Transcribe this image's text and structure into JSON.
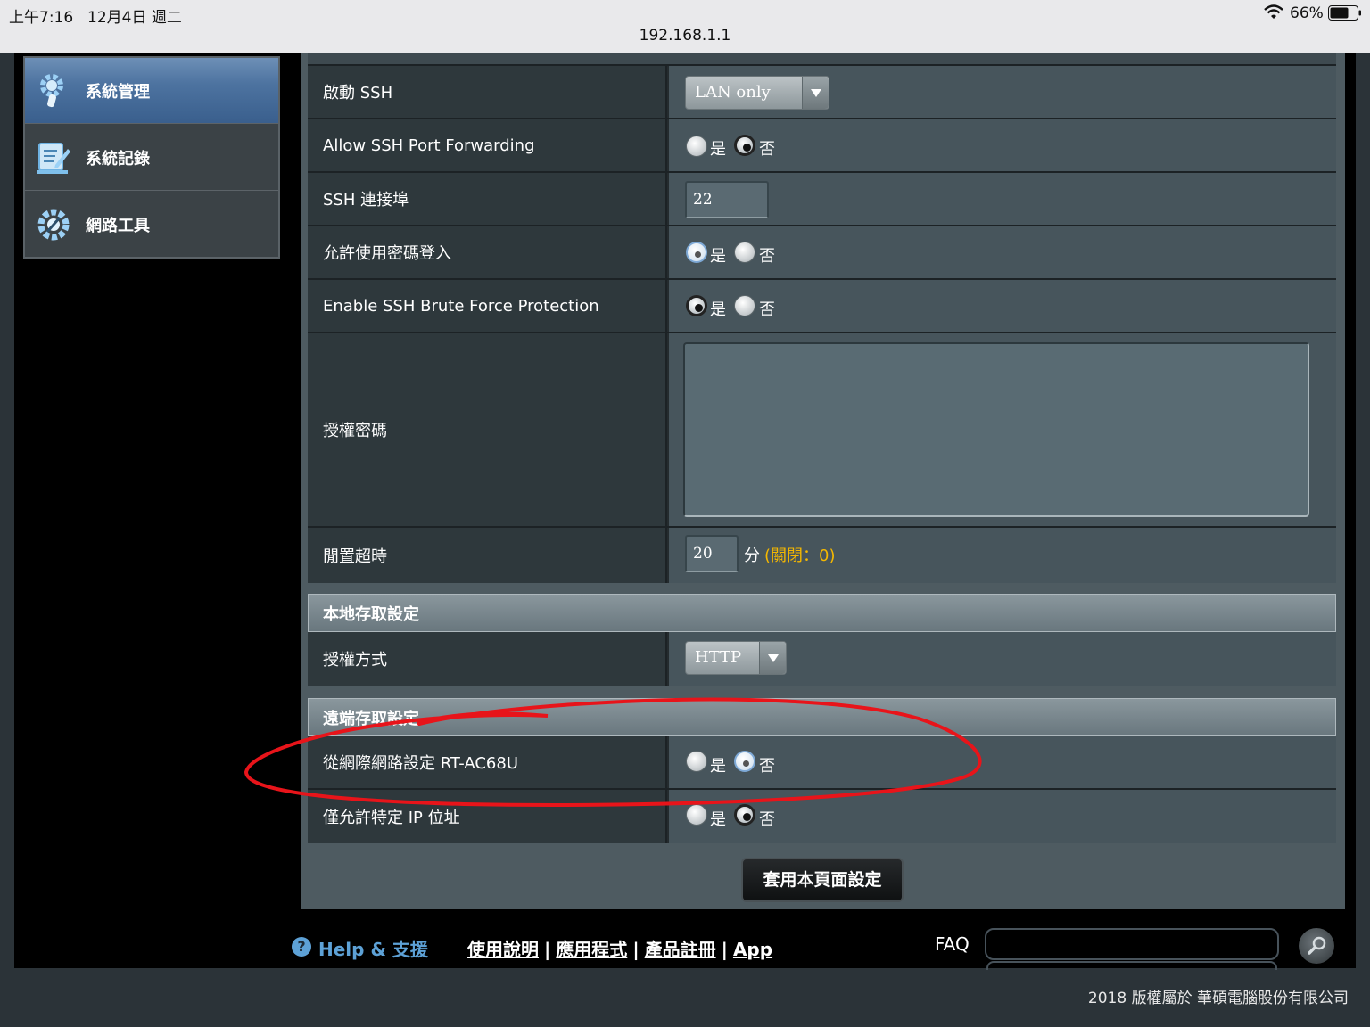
{
  "status_bar": {
    "time": "上午7:16",
    "date": "12月4日 週二",
    "url": "192.168.1.1",
    "battery_pct": "66%"
  },
  "menu": [
    {
      "label": "系統管理",
      "icon": "gear-wrench-icon",
      "active": true
    },
    {
      "label": "系統記錄",
      "icon": "log-edit-icon",
      "active": false
    },
    {
      "label": "網路工具",
      "icon": "gear-tools-icon",
      "active": false
    }
  ],
  "ssh": {
    "enable_label": "啟動 SSH",
    "enable_value": "LAN only",
    "port_forward_label": "Allow SSH Port Forwarding",
    "port_label": "SSH 連接埠",
    "port_value": "22",
    "password_login_label": "允許使用密碼登入",
    "brute_force_label": "Enable SSH Brute Force Protection",
    "auth_key_label": "授權密碼",
    "idle_timeout_label": "閒置超時",
    "idle_timeout_value": "20",
    "idle_timeout_unit": "分",
    "idle_timeout_hint": "(關閉：0)"
  },
  "local_access": {
    "header": "本地存取設定",
    "auth_method_label": "授權方式",
    "auth_method_value": "HTTP"
  },
  "remote_access": {
    "header": "遠端存取設定",
    "wan_access_label": "從網際網路設定 RT-AC68U",
    "specific_ip_label": "僅允許特定 IP 位址"
  },
  "radio": {
    "yes": "是",
    "no": "否"
  },
  "apply_label": "套用本頁面設定",
  "footer": {
    "help_label": "Help & 支援",
    "links": [
      "使用說明",
      "應用程式",
      "產品註冊",
      "App"
    ],
    "faq_label": "FAQ",
    "copyright": "2018 版權屬於 華碩電腦股份有限公司"
  },
  "colors": {
    "accent_blue": "#5da1d6",
    "hint_yellow": "#f5b800",
    "annotation_red": "#e8141a"
  }
}
